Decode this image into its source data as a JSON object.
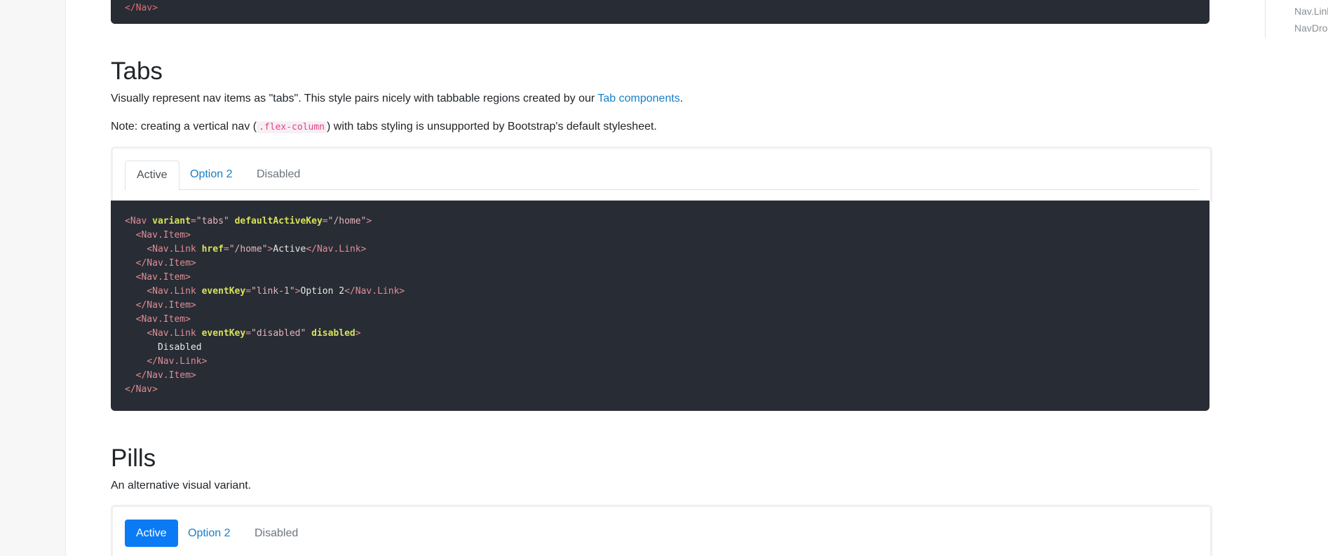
{
  "toc": {
    "items": [
      "Nav.Link",
      "NavDrop"
    ]
  },
  "top_code": {
    "closing_line": "</Nav>"
  },
  "tabs_section": {
    "title": "Tabs",
    "description_pre": "Visually represent nav items as \"tabs\". This style pairs nicely with tabbable regions created by our ",
    "description_link": "Tab components",
    "description_post": ".",
    "note_pre": "Note: creating a vertical nav (",
    "note_code": ".flex-column",
    "note_post": ") with tabs styling is unsupported by Bootstrap's default stylesheet.",
    "tabs": [
      {
        "label": "Active",
        "state": "active"
      },
      {
        "label": "Option 2",
        "state": "link"
      },
      {
        "label": "Disabled",
        "state": "disabled"
      }
    ],
    "code_lines": [
      {
        "indent": "",
        "parts": [
          [
            "tag",
            "<Nav "
          ],
          [
            "attr",
            "variant"
          ],
          [
            "tag",
            "="
          ],
          [
            "str",
            "\"tabs\" "
          ],
          [
            "attr",
            "defaultActiveKey"
          ],
          [
            "tag",
            "="
          ],
          [
            "str",
            "\"/home\""
          ],
          [
            "tag",
            ">"
          ]
        ]
      },
      {
        "indent": "  ",
        "parts": [
          [
            "tag",
            "<Nav.Item>"
          ]
        ]
      },
      {
        "indent": "    ",
        "parts": [
          [
            "tag",
            "<Nav.Link "
          ],
          [
            "attr",
            "href"
          ],
          [
            "tag",
            "="
          ],
          [
            "str",
            "\"/home\""
          ],
          [
            "tag",
            ">"
          ],
          [
            "txt",
            "Active"
          ],
          [
            "tag",
            "</Nav.Link>"
          ]
        ]
      },
      {
        "indent": "  ",
        "parts": [
          [
            "tag",
            "</Nav.Item>"
          ]
        ]
      },
      {
        "indent": "  ",
        "parts": [
          [
            "tag",
            "<Nav.Item>"
          ]
        ]
      },
      {
        "indent": "    ",
        "parts": [
          [
            "tag",
            "<Nav.Link "
          ],
          [
            "attr",
            "eventKey"
          ],
          [
            "tag",
            "="
          ],
          [
            "str",
            "\"link-1\""
          ],
          [
            "tag",
            ">"
          ],
          [
            "txt",
            "Option 2"
          ],
          [
            "tag",
            "</Nav.Link>"
          ]
        ]
      },
      {
        "indent": "  ",
        "parts": [
          [
            "tag",
            "</Nav.Item>"
          ]
        ]
      },
      {
        "indent": "  ",
        "parts": [
          [
            "tag",
            "<Nav.Item>"
          ]
        ]
      },
      {
        "indent": "    ",
        "parts": [
          [
            "tag",
            "<Nav.Link "
          ],
          [
            "attr",
            "eventKey"
          ],
          [
            "tag",
            "="
          ],
          [
            "str",
            "\"disabled\" "
          ],
          [
            "attr",
            "disabled"
          ],
          [
            "tag",
            ">"
          ]
        ]
      },
      {
        "indent": "      ",
        "parts": [
          [
            "txt",
            "Disabled"
          ]
        ]
      },
      {
        "indent": "    ",
        "parts": [
          [
            "tag",
            "</Nav.Link>"
          ]
        ]
      },
      {
        "indent": "  ",
        "parts": [
          [
            "tag",
            "</Nav.Item>"
          ]
        ]
      },
      {
        "indent": "",
        "parts": [
          [
            "tag",
            "</Nav>"
          ]
        ]
      }
    ]
  },
  "pills_section": {
    "title": "Pills",
    "description": "An alternative visual variant.",
    "pills": [
      {
        "label": "Active",
        "state": "active"
      },
      {
        "label": "Option 2",
        "state": "link"
      },
      {
        "label": "Disabled",
        "state": "disabled"
      }
    ]
  },
  "colors": {
    "link": "#1780c7",
    "pill_active": "#0a7bf5",
    "code_bg": "#282c34"
  }
}
